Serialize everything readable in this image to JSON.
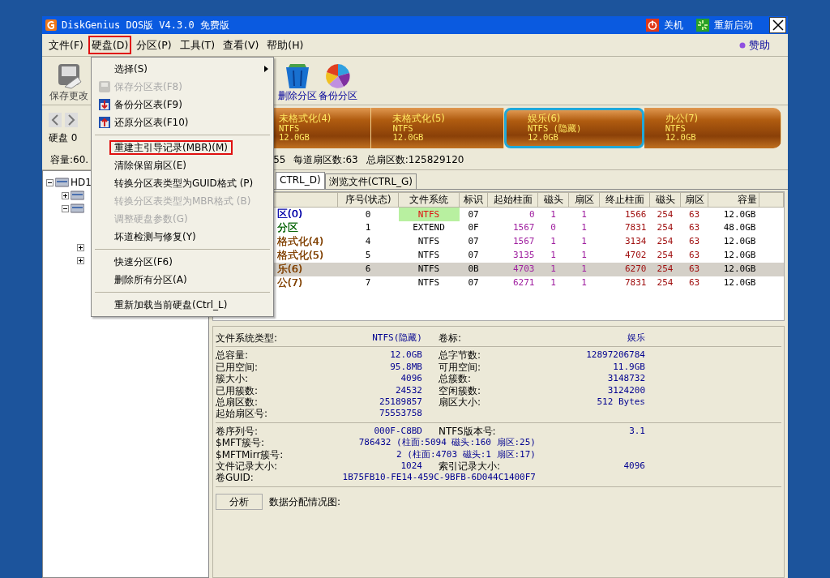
{
  "window": {
    "title": "DiskGenius DOS版 V4.3.0 免费版",
    "actions": [
      {
        "kind": "shutdown",
        "label": "关机"
      },
      {
        "kind": "restart",
        "label": "重新启动"
      }
    ]
  },
  "menubar": {
    "items": [
      {
        "label": "文件(F)",
        "outlined": false
      },
      {
        "label": "硬盘(D)",
        "outlined": true
      },
      {
        "label": "分区(P)",
        "outlined": false
      },
      {
        "label": "工具(T)",
        "outlined": false
      },
      {
        "label": "查看(V)",
        "outlined": false
      },
      {
        "label": "帮助(H)",
        "outlined": false
      }
    ],
    "sponsor": "赞助"
  },
  "dropdown": [
    {
      "kind": "submenu",
      "label": "选择(S)",
      "disabled": false,
      "outlined": false
    },
    {
      "kind": "save",
      "label": "保存分区表(F8)",
      "disabled": true,
      "outlined": false
    },
    {
      "kind": "backup",
      "label": "备份分区表(F9)",
      "disabled": false,
      "outlined": false
    },
    {
      "kind": "restore",
      "label": "还原分区表(F10)",
      "disabled": false,
      "outlined": false
    },
    {
      "kind": "separator"
    },
    {
      "kind": "item",
      "label": "重建主引导记录(MBR)(M)",
      "disabled": false,
      "outlined": true
    },
    {
      "kind": "item",
      "label": "清除保留扇区(E)",
      "disabled": false,
      "outlined": false
    },
    {
      "kind": "item",
      "label": "转换分区表类型为GUID格式 (P)",
      "disabled": false,
      "outlined": false
    },
    {
      "kind": "item",
      "label": "转换分区表类型为MBR格式 (B)",
      "disabled": true,
      "outlined": false
    },
    {
      "kind": "item",
      "label": "调整硬盘参数(G)",
      "disabled": true,
      "outlined": false
    },
    {
      "kind": "item",
      "label": "坏道检测与修复(Y)",
      "disabled": false,
      "outlined": false
    },
    {
      "kind": "separator"
    },
    {
      "kind": "item",
      "label": "快速分区(F6)",
      "disabled": false,
      "outlined": false
    },
    {
      "kind": "item",
      "label": "删除所有分区(A)",
      "disabled": false,
      "outlined": false
    },
    {
      "kind": "separator"
    },
    {
      "kind": "item",
      "label": "重新加载当前硬盘(Ctrl_L)",
      "disabled": false,
      "outlined": false
    }
  ],
  "toolbar": [
    {
      "kind": "save",
      "label": "保存更改",
      "disabled": true
    },
    {
      "kind": "delete",
      "label": "删除分区",
      "disabled": false
    },
    {
      "kind": "backup",
      "label": "备份分区",
      "disabled": false
    }
  ],
  "disk_label": "硬盘 0",
  "partition_bar": [
    {
      "label": "未格式化(4)",
      "fs": "NTFS",
      "size": "12.0GB",
      "selected": false
    },
    {
      "label": "未格式化(5)",
      "fs": "NTFS",
      "size": "12.0GB",
      "selected": false
    },
    {
      "label": "娱乐(6)",
      "fs": "NTFS (隐藏)",
      "size": "12.0GB",
      "selected": true
    },
    {
      "label": "办公(7)",
      "fs": "NTFS",
      "size": "12.0GB",
      "selected": false
    }
  ],
  "info_line": {
    "capacity": "容量:60.",
    "heads": "55",
    "sectors_per_track": "每道扇区数:63",
    "total_sectors": "总扇区数:125829120"
  },
  "tree": [
    {
      "label": "HD1",
      "expanded": true,
      "children": [
        {
          "expanded": false
        },
        {
          "expanded": true,
          "children": [
            {
              "expanded": false
            },
            {
              "expanded": false
            }
          ]
        }
      ]
    }
  ],
  "tabs": [
    {
      "label": "CTRL_D)",
      "selected": true
    },
    {
      "label": "浏览文件(CTRL_G)",
      "selected": false
    }
  ],
  "table": {
    "columns": [
      "",
      "序号(状态)",
      "文件系统",
      "标识",
      "起始柱面",
      "磁头",
      "扇区",
      "终止柱面",
      "磁头",
      "扇区",
      "容量"
    ],
    "rows": [
      {
        "name": "区(0)",
        "color": "#0000a8",
        "index": "0",
        "fs": "NTFS",
        "fs_active": true,
        "id": "07",
        "start_cyl": "0",
        "start_head": "1",
        "start_sector": "1",
        "end_cyl": "1566",
        "end_head": "254",
        "end_sector": "63",
        "size": "12.0GB",
        "selected": false
      },
      {
        "name": "分区",
        "color": "#006000",
        "index": "1",
        "fs": "EXTEND",
        "fs_active": false,
        "id": "0F",
        "start_cyl": "1567",
        "start_head": "0",
        "start_sector": "1",
        "end_cyl": "7831",
        "end_head": "254",
        "end_sector": "63",
        "size": "48.0GB",
        "selected": false
      },
      {
        "name": "格式化(4)",
        "color": "#804000",
        "index": "4",
        "fs": "NTFS",
        "fs_active": false,
        "id": "07",
        "start_cyl": "1567",
        "start_head": "1",
        "start_sector": "1",
        "end_cyl": "3134",
        "end_head": "254",
        "end_sector": "63",
        "size": "12.0GB",
        "selected": false
      },
      {
        "name": "格式化(5)",
        "color": "#804000",
        "index": "5",
        "fs": "NTFS",
        "fs_active": false,
        "id": "07",
        "start_cyl": "3135",
        "start_head": "1",
        "start_sector": "1",
        "end_cyl": "4702",
        "end_head": "254",
        "end_sector": "63",
        "size": "12.0GB",
        "selected": false
      },
      {
        "name": "乐(6)",
        "color": "#804000",
        "index": "6",
        "fs": "NTFS",
        "fs_active": false,
        "id": "0B",
        "start_cyl": "4703",
        "start_head": "1",
        "start_sector": "1",
        "end_cyl": "6270",
        "end_head": "254",
        "end_sector": "63",
        "size": "12.0GB",
        "selected": true
      },
      {
        "name": "公(7)",
        "color": "#804000",
        "index": "7",
        "fs": "NTFS",
        "fs_active": false,
        "id": "07",
        "start_cyl": "6271",
        "start_head": "1",
        "start_sector": "1",
        "end_cyl": "7831",
        "end_head": "254",
        "end_sector": "63",
        "size": "12.0GB",
        "selected": false
      }
    ]
  },
  "details": [
    {
      "rows": [
        {
          "kind": "pair",
          "label": "文件系统类型:",
          "value": "NTFS(隐藏)",
          "label2": "卷标:",
          "value2": "娱乐"
        }
      ]
    },
    {
      "rows": [
        {
          "kind": "pair",
          "label": "总容量:",
          "value": "12.0GB",
          "label2": "总字节数:",
          "value2": "12897206784"
        },
        {
          "kind": "pair",
          "label": "已用空间:",
          "value": "95.8MB",
          "label2": "可用空间:",
          "value2": "11.9GB"
        },
        {
          "kind": "pair",
          "label": "簇大小:",
          "value": "4096",
          "label2": "总簇数:",
          "value2": "3148732"
        },
        {
          "kind": "pair",
          "label": "已用簇数:",
          "value": "24532",
          "label2": "空闲簇数:",
          "value2": "3124200"
        },
        {
          "kind": "pair",
          "label": "总扇区数:",
          "value": "25189857",
          "label2": "扇区大小:",
          "value2": "512 Bytes"
        },
        {
          "kind": "pair",
          "label": "起始扇区号:",
          "value": "75553758"
        }
      ]
    },
    {
      "rows": [
        {
          "kind": "pair",
          "label": "卷序列号:",
          "value": "000F-C8BD",
          "label2": "NTFS版本号:",
          "value2": "3.1"
        },
        {
          "kind": "wide",
          "label": "$MFT簇号:",
          "value": "786432 (柱面:5094 磁头:160 扇区:25)"
        },
        {
          "kind": "wide",
          "label": "$MFTMirr簇号:",
          "value": "2 (柱面:4703 磁头:1 扇区:17)"
        },
        {
          "kind": "pair",
          "label": "文件记录大小:",
          "value": "1024",
          "label2": "索引记录大小:",
          "value2": "4096"
        },
        {
          "kind": "wide",
          "label": "卷GUID:",
          "value": "1B75FB10-FE14-459C-9BFB-6D044C1400F7"
        }
      ]
    }
  ],
  "analyze_button": "分析",
  "allocation_label": "数据分配情况图:"
}
